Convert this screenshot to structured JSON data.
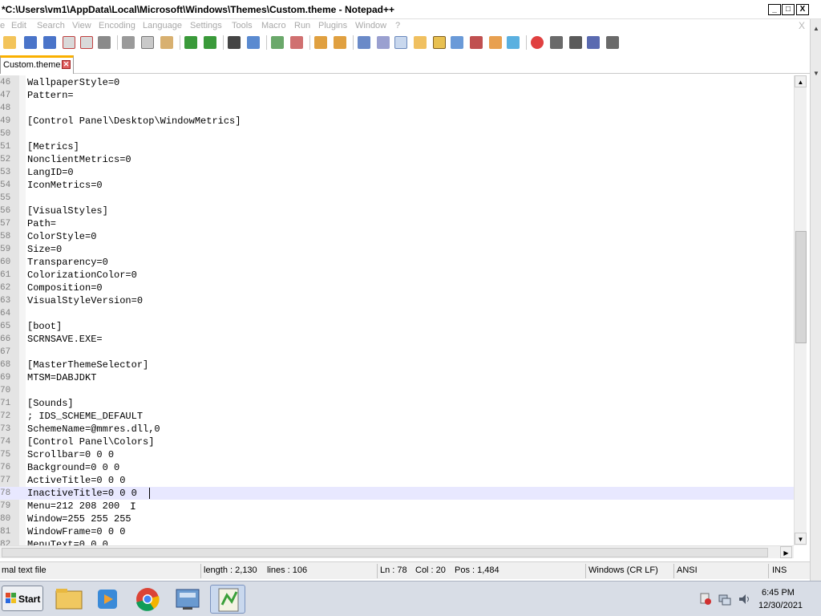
{
  "window": {
    "title": "*C:\\Users\\vm1\\AppData\\Local\\Microsoft\\Windows\\Themes\\Custom.theme - Notepad++",
    "controls": {
      "minimize": "_",
      "maximize": "□",
      "close": "X"
    }
  },
  "menu": {
    "items": [
      "e",
      "Edit",
      "Search",
      "View",
      "Encoding",
      "Language",
      "Settings",
      "Tools",
      "Macro",
      "Run",
      "Plugins",
      "Window",
      "?"
    ],
    "close_glyph": "X"
  },
  "toolbar": {
    "icons": [
      "new-file-icon",
      "open-file-icon",
      "save-icon",
      "save-all-icon",
      "close-icon",
      "close-all-icon",
      "print-icon",
      "cut-icon",
      "copy-icon",
      "paste-icon",
      "undo-icon",
      "redo-icon",
      "find-icon",
      "replace-icon",
      "zoom-in-icon",
      "zoom-out-icon",
      "sync-vertical-icon",
      "sync-horizontal-icon",
      "word-wrap-icon",
      "show-all-chars-icon",
      "indent-guide-icon",
      "udl-icon",
      "doc-map-icon",
      "function-list-icon",
      "folder-as-workspace-icon",
      "monitoring-icon",
      "record-macro-icon",
      "stop-macro-icon",
      "play-macro-icon",
      "run-macro-multiple-icon",
      "save-macro-icon"
    ]
  },
  "tab": {
    "label": "Custom.theme",
    "close_glyph": "✕"
  },
  "editor": {
    "lines": [
      {
        "n": "46",
        "text": "WallpaperStyle=0"
      },
      {
        "n": "47",
        "text": "Pattern="
      },
      {
        "n": "48",
        "text": ""
      },
      {
        "n": "49",
        "text": "[Control Panel\\Desktop\\WindowMetrics]"
      },
      {
        "n": "50",
        "text": ""
      },
      {
        "n": "51",
        "text": "[Metrics]"
      },
      {
        "n": "52",
        "text": "NonclientMetrics=0"
      },
      {
        "n": "53",
        "text": "LangID=0"
      },
      {
        "n": "54",
        "text": "IconMetrics=0"
      },
      {
        "n": "55",
        "text": ""
      },
      {
        "n": "56",
        "text": "[VisualStyles]"
      },
      {
        "n": "57",
        "text": "Path="
      },
      {
        "n": "58",
        "text": "ColorStyle=0"
      },
      {
        "n": "59",
        "text": "Size=0"
      },
      {
        "n": "60",
        "text": "Transparency=0"
      },
      {
        "n": "61",
        "text": "ColorizationColor=0"
      },
      {
        "n": "62",
        "text": "Composition=0"
      },
      {
        "n": "63",
        "text": "VisualStyleVersion=0"
      },
      {
        "n": "64",
        "text": ""
      },
      {
        "n": "65",
        "text": "[boot]"
      },
      {
        "n": "66",
        "text": "SCRNSAVE.EXE="
      },
      {
        "n": "67",
        "text": ""
      },
      {
        "n": "68",
        "text": "[MasterThemeSelector]"
      },
      {
        "n": "69",
        "text": "MTSM=DABJDKT"
      },
      {
        "n": "70",
        "text": ""
      },
      {
        "n": "71",
        "text": "[Sounds]"
      },
      {
        "n": "72",
        "text": "; IDS_SCHEME_DEFAULT"
      },
      {
        "n": "73",
        "text": "SchemeName=@mmres.dll,0"
      },
      {
        "n": "74",
        "text": "[Control Panel\\Colors]"
      },
      {
        "n": "75",
        "text": "Scrollbar=0 0 0"
      },
      {
        "n": "76",
        "text": "Background=0 0 0"
      },
      {
        "n": "77",
        "text": "ActiveTitle=0 0 0"
      },
      {
        "n": "78",
        "text": "InactiveTitle=0 0 0"
      },
      {
        "n": "79",
        "text": "Menu=212 208 200"
      },
      {
        "n": "80",
        "text": "Window=255 255 255"
      },
      {
        "n": "81",
        "text": "WindowFrame=0 0 0"
      },
      {
        "n": "82",
        "text": "MenuText=0 0 0"
      }
    ],
    "current_line": 78,
    "current_line_color": "#e8e8ff"
  },
  "statusbar": {
    "filetype": "mal text file",
    "length": "length : 2,130",
    "lines": "lines : 106",
    "ln": "Ln : 78",
    "col": "Col : 20",
    "pos": "Pos : 1,484",
    "eol": "Windows (CR LF)",
    "encoding": "ANSI",
    "mode": "INS"
  },
  "taskbar": {
    "start_label": "Start",
    "apps": [
      "file-explorer-icon",
      "media-player-icon",
      "chrome-icon",
      "server-manager-icon",
      "notepadpp-icon"
    ],
    "tray": [
      "action-center-icon",
      "network-icon",
      "volume-icon"
    ],
    "time": "6:45 PM",
    "date": "12/30/2021"
  },
  "colors": {
    "accent_tab": "#fab000",
    "gutter": "#e4e4e4",
    "taskbar": "#d8dde6"
  }
}
